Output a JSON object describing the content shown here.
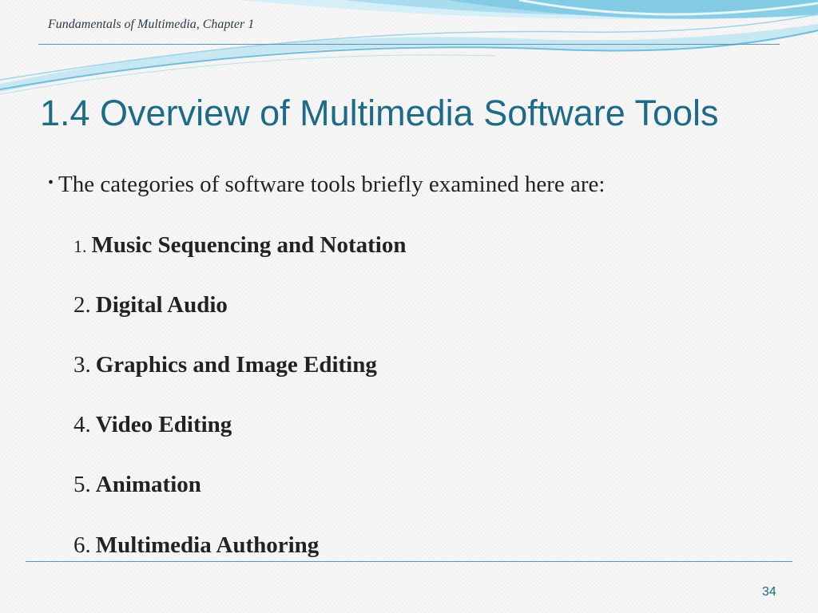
{
  "header": {
    "text": "Fundamentals of Multimedia, Chapter 1"
  },
  "title": "1.4 Overview of Multimedia Software Tools",
  "bullet": {
    "marker": "•",
    "text": "The categories of software tools briefly examined here are:"
  },
  "items": [
    {
      "num": "1.",
      "label": "Music Sequencing and Notation"
    },
    {
      "num": "2.",
      "label": "Digital Audio"
    },
    {
      "num": "3.",
      "label": "Graphics and Image Editing"
    },
    {
      "num": "4.",
      "label": "Video Editing"
    },
    {
      "num": "5.",
      "label": "Animation"
    },
    {
      "num": "6.",
      "label": "Multimedia Authoring"
    }
  ],
  "page_number": "34",
  "colors": {
    "accent": "#1d6b86",
    "rule": "#5f95b3",
    "wave_light": "#bfe3f2",
    "wave_dark": "#5fb6d8"
  }
}
